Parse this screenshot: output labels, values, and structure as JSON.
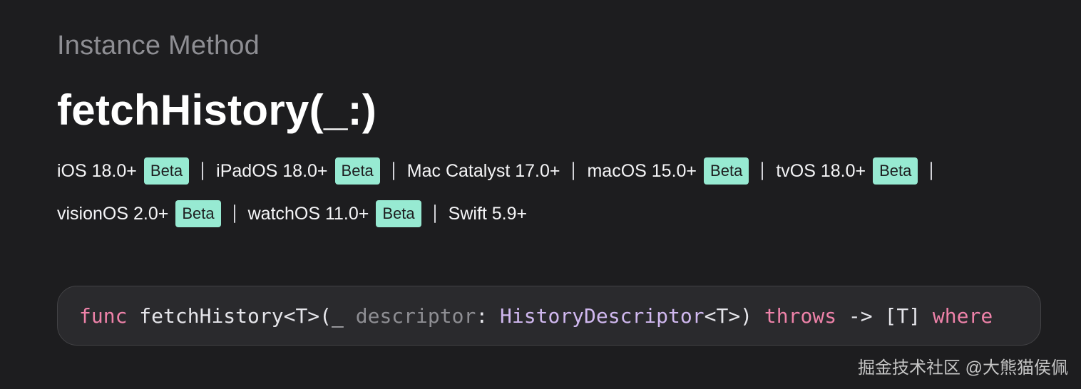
{
  "header": {
    "eyebrow": "Instance Method",
    "title": "fetchHistory(_:)"
  },
  "availability": {
    "rows": [
      [
        {
          "name": "iOS 18.0+",
          "badge": "Beta"
        },
        {
          "name": "iPadOS 18.0+",
          "badge": "Beta"
        },
        {
          "name": "Mac Catalyst 17.0+",
          "badge": null
        },
        {
          "name": "macOS 15.0+",
          "badge": "Beta"
        },
        {
          "name": "tvOS 18.0+",
          "badge": "Beta"
        }
      ],
      [
        {
          "name": "visionOS 2.0+",
          "badge": "Beta"
        },
        {
          "name": "watchOS 11.0+",
          "badge": "Beta"
        },
        {
          "name": "Swift 5.9+",
          "badge": null
        }
      ]
    ]
  },
  "declaration": {
    "tokens": [
      {
        "text": "func",
        "kind": "kw"
      },
      {
        "text": " fetchHistory<T>(_ ",
        "kind": "plain"
      },
      {
        "text": "descriptor",
        "kind": "param"
      },
      {
        "text": ": ",
        "kind": "plain"
      },
      {
        "text": "HistoryDescriptor",
        "kind": "type"
      },
      {
        "text": "<T>) ",
        "kind": "plain"
      },
      {
        "text": "throws",
        "kind": "kw"
      },
      {
        "text": " -> [T] ",
        "kind": "plain"
      },
      {
        "text": "where",
        "kind": "kw"
      }
    ]
  },
  "colors": {
    "background": "#1d1d1f",
    "badge": "#97ead2",
    "keyword": "#ee82a9",
    "type": "#d0b8ef",
    "param": "#8e8e93"
  },
  "watermark": {
    "text": "掘金技术社区 @大熊猫侯佩"
  }
}
